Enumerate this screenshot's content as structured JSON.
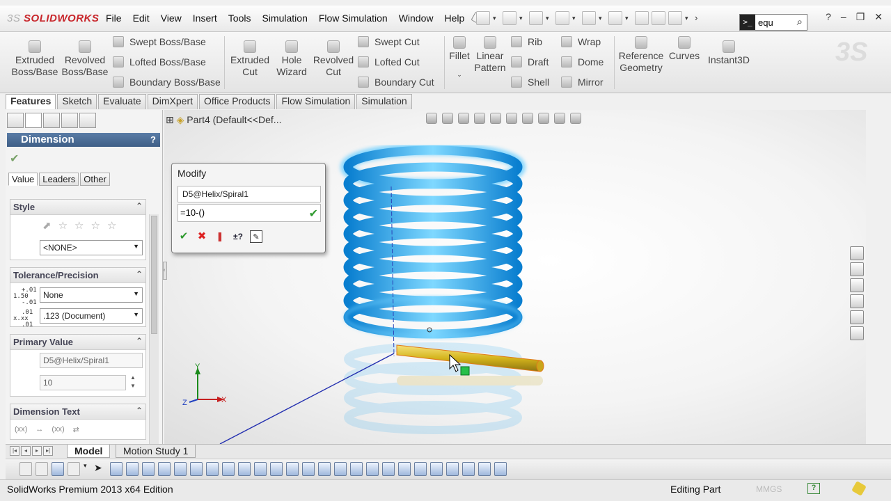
{
  "app": {
    "brand_prefix": "3S",
    "brand": "SOLIDWORKS"
  },
  "menu": [
    "File",
    "Edit",
    "View",
    "Insert",
    "Tools",
    "Simulation",
    "Flow Simulation",
    "Window",
    "Help"
  ],
  "search": {
    "value": "equ"
  },
  "commands": {
    "extruded_boss": "Extruded Boss/Base",
    "revolved_boss": "Revolved Boss/Base",
    "swept_boss": "Swept Boss/Base",
    "lofted_boss": "Lofted Boss/Base",
    "boundary_boss": "Boundary Boss/Base",
    "extruded_cut": "Extruded Cut",
    "hole_wizard": "Hole Wizard",
    "revolved_cut": "Revolved Cut",
    "swept_cut": "Swept Cut",
    "lofted_cut": "Lofted Cut",
    "boundary_cut": "Boundary Cut",
    "fillet": "Fillet",
    "linear_pattern": "Linear Pattern",
    "rib": "Rib",
    "draft": "Draft",
    "shell": "Shell",
    "wrap": "Wrap",
    "dome": "Dome",
    "mirror": "Mirror",
    "reference_geometry": "Reference Geometry",
    "curves": "Curves",
    "instant3d": "Instant3D"
  },
  "tabs": [
    "Features",
    "Sketch",
    "Evaluate",
    "DimXpert",
    "Office Products",
    "Flow Simulation",
    "Simulation"
  ],
  "property_manager": {
    "title": "Dimension",
    "help": "?",
    "subtabs": [
      "Value",
      "Leaders",
      "Other"
    ],
    "style": {
      "header": "Style",
      "selected": "<NONE>"
    },
    "tolerance": {
      "header": "Tolerance/Precision",
      "type": "None",
      "precision": ".123 (Document)",
      "tol_icon_top": "+.01",
      "tol_icon_mid": "1.50",
      "tol_icon_bot": "-.01",
      "prec_icon_top": ".01",
      "prec_icon_mid": "x.xx",
      "prec_icon_bot": ".01"
    },
    "primary_value": {
      "header": "Primary Value",
      "name": "D5@Helix/Spiral1",
      "value": "10"
    },
    "dimension_text": {
      "header": "Dimension Text"
    }
  },
  "viewport": {
    "tree_label": "Part4  (Default<<Def..."
  },
  "modify": {
    "title": "Modify",
    "name": "D5@Helix/Spiral1",
    "value": "=10-()"
  },
  "bottom_tabs": [
    "Model",
    "Motion Study 1"
  ],
  "status": {
    "edition": "SolidWorks Premium 2013 x64 Edition",
    "state": "Editing Part",
    "units": "MMGS"
  },
  "colors": {
    "coil": "#1aa7ef",
    "rod": "#d4b41c",
    "header": "#4a6d96"
  }
}
